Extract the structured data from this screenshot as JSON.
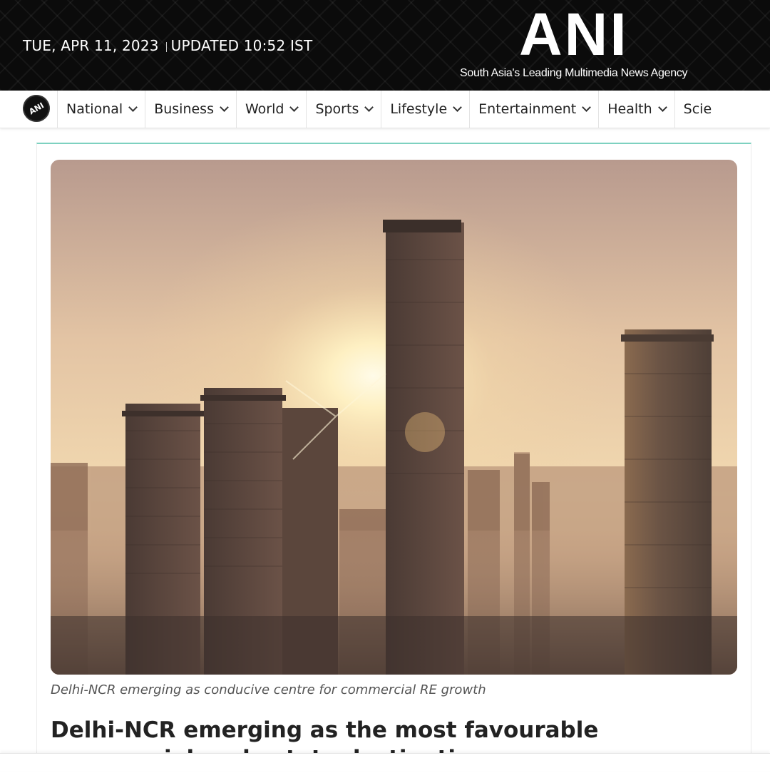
{
  "header": {
    "date": "TUE, APR 11, 2023",
    "updated": "UPDATED 10:52 IST",
    "logo_text": "ANI",
    "tagline": "South Asia's Leading Multimedia News Agency"
  },
  "nav": {
    "logo_icon": "ani-round-logo",
    "logo_text": "ANI",
    "items": [
      {
        "label": "National"
      },
      {
        "label": "Business"
      },
      {
        "label": "World"
      },
      {
        "label": "Sports"
      },
      {
        "label": "Lifestyle"
      },
      {
        "label": "Entertainment"
      },
      {
        "label": "Health"
      },
      {
        "label": "Scie"
      }
    ]
  },
  "article": {
    "image_caption": "Delhi-NCR emerging as conducive centre for commercial RE growth",
    "headline": "Delhi-NCR emerging as the most favourable commercial real estate destination"
  },
  "colors": {
    "accent": "#7dd1c0",
    "header_bg": "#0b0b0b"
  }
}
